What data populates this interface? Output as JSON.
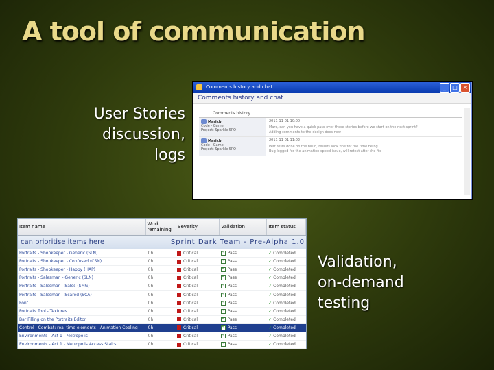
{
  "slide": {
    "title": "A tool of communication",
    "left_caption_lines": [
      "User Stories",
      "discussion,",
      "logs"
    ],
    "right_caption_lines": [
      "Validation,",
      "on-demand",
      "testing"
    ]
  },
  "comments_window": {
    "titlebar": "Comments history and chat",
    "header": "Comments history and chat",
    "section_label": "Comments history",
    "entries": [
      {
        "author": "Marikb",
        "details": "Code - Game",
        "project": "Project: Sparkle SPO",
        "timestamp": "2011-11-01 10:00",
        "text_lines": [
          "Marc, can you have a quick pass over these stories before we start on the next sprint?",
          "Adding comments to the design docs now"
        ]
      },
      {
        "author": "Marikb",
        "details": "Code - Game",
        "project": "Project: Sparkle SPO",
        "timestamp": "2011-11-01 11:02",
        "text_lines": [
          "Perf tests done on the build, results look fine for the time being.",
          "Bug logged for the animation speed issue, will retest after the fix"
        ]
      }
    ]
  },
  "backlog": {
    "columns": [
      "Item name",
      "Work remaining",
      "Severity",
      "Validation",
      "Item status"
    ],
    "banner_left": "can prioritise items here",
    "banner_right": "Sprint Dark Team - Pre-Alpha 1.0",
    "rows": [
      {
        "name": "Portraits - Shopkeeper - Generic (SLN)",
        "work": "0h",
        "severity": "Critical",
        "validation": "Pass",
        "status": "Completed",
        "selected": false
      },
      {
        "name": "Portraits - Shopkeeper - Confused (CSN)",
        "work": "0h",
        "severity": "Critical",
        "validation": "Pass",
        "status": "Completed",
        "selected": false
      },
      {
        "name": "Portraits - Shopkeeper - Happy (HAP)",
        "work": "0h",
        "severity": "Critical",
        "validation": "Pass",
        "status": "Completed",
        "selected": false
      },
      {
        "name": "Portraits - Salesman - Generic (SLN)",
        "work": "0h",
        "severity": "Critical",
        "validation": "Pass",
        "status": "Completed",
        "selected": false
      },
      {
        "name": "Portraits - Salesman - Sales (SMG)",
        "work": "0h",
        "severity": "Critical",
        "validation": "Pass",
        "status": "Completed",
        "selected": false
      },
      {
        "name": "Portraits - Salesman - Scared (SCA)",
        "work": "0h",
        "severity": "Critical",
        "validation": "Pass",
        "status": "Completed",
        "selected": false
      },
      {
        "name": "Font",
        "work": "0h",
        "severity": "Critical",
        "validation": "Pass",
        "status": "Completed",
        "selected": false
      },
      {
        "name": "Portraits Tool - Textures",
        "work": "0h",
        "severity": "Critical",
        "validation": "Pass",
        "status": "Completed",
        "selected": false
      },
      {
        "name": "Bar Filling on the Portraits Editor",
        "work": "0h",
        "severity": "Critical",
        "validation": "Pass",
        "status": "Completed",
        "selected": false
      },
      {
        "name": "Control - Combat: real time elements - Animation Cooling",
        "work": "0h",
        "severity": "Critical",
        "validation": "Pass",
        "status": "Completed",
        "selected": true
      },
      {
        "name": "Environments - Act 1 - Metropolis",
        "work": "0h",
        "severity": "Critical",
        "validation": "Pass",
        "status": "Completed",
        "selected": false
      },
      {
        "name": "Environments - Act 1 - Metropolis Access Stairs",
        "work": "0h",
        "severity": "Critical",
        "validation": "Pass",
        "status": "Completed",
        "selected": false
      }
    ]
  }
}
